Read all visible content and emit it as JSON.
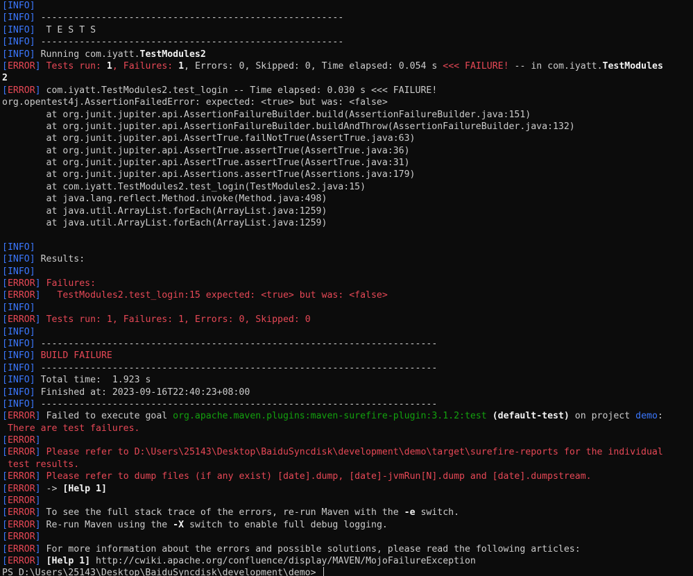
{
  "lines": [
    {
      "p": "[INFO]",
      "s": [
        {
          "t": ""
        }
      ]
    },
    {
      "p": "[INFO]",
      "s": [
        {
          "t": " -------------------------------------------------------"
        }
      ]
    },
    {
      "p": "[INFO]",
      "s": [
        {
          "t": "  T E S T S"
        }
      ]
    },
    {
      "p": "[INFO]",
      "s": [
        {
          "t": " -------------------------------------------------------"
        }
      ]
    },
    {
      "p": "[INFO]",
      "s": [
        {
          "t": " Running com.iyatt."
        },
        {
          "t": "TestModules2",
          "c": "bright"
        }
      ]
    },
    {
      "p": "[ERROR]",
      "s": [
        {
          "t": " "
        },
        {
          "t": "Tests run: ",
          "c": "error"
        },
        {
          "t": "1",
          "c": "bright"
        },
        {
          "t": ", ",
          "c": "error"
        },
        {
          "t": "Failures: ",
          "c": "error"
        },
        {
          "t": "1",
          "c": "bright"
        },
        {
          "t": ", Errors: 0, Skipped: 0, Time elapsed: 0.054 s "
        },
        {
          "t": "<<< FAILURE!",
          "c": "error"
        },
        {
          "t": " -- in com.iyatt."
        },
        {
          "t": "TestModules",
          "c": "bright"
        }
      ]
    },
    {
      "s": [
        {
          "t": "2",
          "c": "bright"
        }
      ]
    },
    {
      "p": "[ERROR]",
      "s": [
        {
          "t": " com.iyatt.TestModules2.test_login -- Time elapsed: 0.030 s <<< FAILURE!"
        }
      ]
    },
    {
      "s": [
        {
          "t": "org.opentest4j.AssertionFailedError: expected: <true> but was: <false>"
        }
      ]
    },
    {
      "s": [
        {
          "t": "        at org.junit.jupiter.api.AssertionFailureBuilder.build(AssertionFailureBuilder.java:151)"
        }
      ]
    },
    {
      "s": [
        {
          "t": "        at org.junit.jupiter.api.AssertionFailureBuilder.buildAndThrow(AssertionFailureBuilder.java:132)"
        }
      ]
    },
    {
      "s": [
        {
          "t": "        at org.junit.jupiter.api.AssertTrue.failNotTrue(AssertTrue.java:63)"
        }
      ]
    },
    {
      "s": [
        {
          "t": "        at org.junit.jupiter.api.AssertTrue.assertTrue(AssertTrue.java:36)"
        }
      ]
    },
    {
      "s": [
        {
          "t": "        at org.junit.jupiter.api.AssertTrue.assertTrue(AssertTrue.java:31)"
        }
      ]
    },
    {
      "s": [
        {
          "t": "        at org.junit.jupiter.api.Assertions.assertTrue(Assertions.java:179)"
        }
      ]
    },
    {
      "s": [
        {
          "t": "        at com.iyatt.TestModules2.test_login(TestModules2.java:15)"
        }
      ]
    },
    {
      "s": [
        {
          "t": "        at java.lang.reflect.Method.invoke(Method.java:498)"
        }
      ]
    },
    {
      "s": [
        {
          "t": "        at java.util.ArrayList.forEach(ArrayList.java:1259)"
        }
      ]
    },
    {
      "s": [
        {
          "t": "        at java.util.ArrayList.forEach(ArrayList.java:1259)"
        }
      ]
    },
    {
      "s": [
        {
          "t": ""
        }
      ]
    },
    {
      "p": "[INFO]",
      "s": [
        {
          "t": ""
        }
      ]
    },
    {
      "p": "[INFO]",
      "s": [
        {
          "t": " Results:"
        }
      ]
    },
    {
      "p": "[INFO]",
      "s": [
        {
          "t": ""
        }
      ]
    },
    {
      "p": "[ERROR]",
      "s": [
        {
          "t": " "
        },
        {
          "t": "Failures:",
          "c": "error"
        }
      ]
    },
    {
      "p": "[ERROR]",
      "s": [
        {
          "t": "   TestModules2.test_login:15 expected: <true> but was: <false>",
          "c": "error"
        }
      ]
    },
    {
      "p": "[INFO]",
      "s": [
        {
          "t": ""
        }
      ]
    },
    {
      "p": "[ERROR]",
      "s": [
        {
          "t": " "
        },
        {
          "t": "Tests run: 1, Failures: 1, Errors: 0, Skipped: 0",
          "c": "error"
        }
      ]
    },
    {
      "p": "[INFO]",
      "s": [
        {
          "t": ""
        }
      ]
    },
    {
      "p": "[INFO]",
      "s": [
        {
          "t": " ------------------------------------------------------------------------"
        }
      ]
    },
    {
      "p": "[INFO]",
      "s": [
        {
          "t": " "
        },
        {
          "t": "BUILD FAILURE",
          "c": "error"
        }
      ]
    },
    {
      "p": "[INFO]",
      "s": [
        {
          "t": " ------------------------------------------------------------------------"
        }
      ]
    },
    {
      "p": "[INFO]",
      "s": [
        {
          "t": " Total time:  1.923 s"
        }
      ]
    },
    {
      "p": "[INFO]",
      "s": [
        {
          "t": " Finished at: 2023-09-16T22:40:23+08:00"
        }
      ]
    },
    {
      "p": "[INFO]",
      "s": [
        {
          "t": " ------------------------------------------------------------------------"
        }
      ]
    },
    {
      "p": "[ERROR]",
      "s": [
        {
          "t": " Failed to execute goal "
        },
        {
          "t": "org.apache.maven.plugins:maven-surefire-plugin:3.1.2:test",
          "c": "green"
        },
        {
          "t": " "
        },
        {
          "t": "(default-test)",
          "c": "bright"
        },
        {
          "t": " on project "
        },
        {
          "t": "demo",
          "c": "blue"
        },
        {
          "t": ":"
        }
      ]
    },
    {
      "s": [
        {
          "t": " There are test failures.",
          "c": "error"
        }
      ]
    },
    {
      "p": "[ERROR]",
      "s": [
        {
          "t": ""
        }
      ]
    },
    {
      "p": "[ERROR]",
      "s": [
        {
          "t": " "
        },
        {
          "t": "Please refer to D:\\Users\\25143\\Desktop\\BaiduSyncdisk\\development\\demo\\target\\surefire-reports for the individual",
          "c": "error"
        }
      ]
    },
    {
      "s": [
        {
          "t": " test results.",
          "c": "error"
        }
      ]
    },
    {
      "p": "[ERROR]",
      "s": [
        {
          "t": " "
        },
        {
          "t": "Please refer to dump files (if any exist) [date].dump, [date]-jvmRun[N].dump and [date].dumpstream.",
          "c": "error"
        }
      ]
    },
    {
      "p": "[ERROR]",
      "s": [
        {
          "t": " -> "
        },
        {
          "t": "[Help 1]",
          "c": "bright"
        }
      ]
    },
    {
      "p": "[ERROR]",
      "s": [
        {
          "t": ""
        }
      ]
    },
    {
      "p": "[ERROR]",
      "s": [
        {
          "t": " To see the full stack trace of the errors, re-run Maven with the "
        },
        {
          "t": "-e",
          "c": "bright"
        },
        {
          "t": " switch."
        }
      ]
    },
    {
      "p": "[ERROR]",
      "s": [
        {
          "t": " Re-run Maven using the "
        },
        {
          "t": "-X",
          "c": "bright"
        },
        {
          "t": " switch to enable full debug logging."
        }
      ]
    },
    {
      "p": "[ERROR]",
      "s": [
        {
          "t": ""
        }
      ]
    },
    {
      "p": "[ERROR]",
      "s": [
        {
          "t": " For more information about the errors and possible solutions, please read the following articles:"
        }
      ]
    },
    {
      "p": "[ERROR]",
      "s": [
        {
          "t": " "
        },
        {
          "t": "[Help 1]",
          "c": "bright"
        },
        {
          "t": " http://cwiki.apache.org/confluence/display/MAVEN/MojoFailureException"
        }
      ]
    }
  ],
  "prompt": "PS D:\\Users\\25143\\Desktop\\BaiduSyncdisk\\development\\demo> ",
  "colors": {
    "background": "#0c0c0c",
    "text": "#cccccc",
    "info": "#3b78ff",
    "error": "#e74856",
    "green": "#13a10e",
    "bright": "#f2f2f2"
  }
}
